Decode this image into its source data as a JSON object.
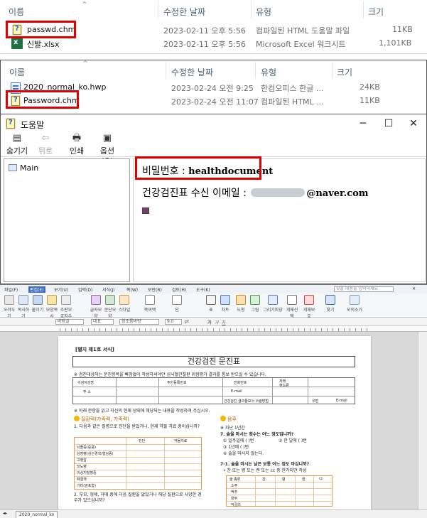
{
  "explorer_top": {
    "columns": {
      "name": "이름",
      "modified": "수정한 날짜",
      "type": "유형",
      "size": "크기"
    },
    "files": [
      {
        "name": "passwd.chm",
        "modified": "2023-02-11 오후 5:56",
        "type": "컴파일된 HTML 도움말 파일",
        "size": "11KB",
        "icon": "chm-help-icon"
      },
      {
        "name": "신발.xlsx",
        "modified": "2023-02-11 오후 5:56",
        "type": "Microsoft Excel 워크시트",
        "size": "1,101KB",
        "icon": "excel-file-icon"
      }
    ]
  },
  "explorer_bottom": {
    "columns": {
      "name": "이름",
      "modified": "수정한 날짜",
      "type": "유형",
      "size": "크기"
    },
    "files": [
      {
        "name": "2020_normal_ko.hwp",
        "modified": "2023-02-24 오전 9:25",
        "type": "한컴오피스 한글 ...",
        "size": "24KB",
        "icon": "hwp-file-icon"
      },
      {
        "name": "Password.chm",
        "modified": "2023-02-24 오전 11:07",
        "type": "컴파일된 HTML ...",
        "size": "11KB",
        "icon": "chm-help-icon"
      }
    ]
  },
  "help_window": {
    "title": "도움말",
    "toolbar": {
      "hide": "숨기기",
      "back": "뒤로",
      "print": "인쇄",
      "options": "옵션(O)"
    },
    "nav_item": "Main",
    "password_label": "비밀번호 : ",
    "password_value": "healthdocument",
    "email_label": "건강검진표 수신 이메일 : ",
    "email_domain": "@naver.com"
  },
  "hwp_editor": {
    "menu": [
      "파일(F)",
      "편집(E)",
      "보기(U)",
      "입력(D)",
      "서식(J)",
      "쪽(W)",
      "보안(R)",
      "검토(H)",
      "도구(K)"
    ],
    "search_placeholder": "찾을 내용을 입력하세요",
    "ribbon": [
      "오려두기",
      "복사하기",
      "붙이기",
      "모양복사",
      "조판부호지우기",
      "글자모양",
      "문단모양",
      "스타일",
      "쪽여백",
      "단",
      "표",
      "차트",
      "도형",
      "그림",
      "그리기마당",
      "개체선택",
      "개체보호",
      "찾기",
      "모의소거"
    ],
    "format": {
      "style": "바탕글",
      "font_face": "대표",
      "font_name": "함초롬바탕",
      "font_size": "9.0",
      "unit": "pt"
    },
    "status_tab": "2020_normal_ko",
    "document": {
      "form_tag": "[별지 제1호 서식]",
      "title": "건강검진 문진표",
      "note": "※ 검진대상자는 문진항목을 빠짐없이 작성하셔야만 심뇌혈관질환 위험평가 결과를 통보 받으실 수 있습니다.",
      "table_labels": [
        "수검자성명",
        "주민등록번호",
        "전화번호",
        "자택",
        "핸드폰",
        "주 소",
        "E-mail",
        "건강검진 결과통보서 수령방법",
        "우편",
        "E-mail"
      ],
      "note2": "※ 아래 문항을 읽고 자신의 현재 상태에 해당되는 내용을 작성하여 주십시오.",
      "section1": "질환력(가족력, 가족력)",
      "q1": "1. 다음과 같은 질병으로 진단을 받았거나, 현재 약물 치료 중이십니까?",
      "q1_diseases": [
        "뇌졸중(중풍)",
        "심장병(심근경색/협심증)",
        "고혈압",
        "당뇨병",
        "이상지질혈증",
        "폐결핵",
        "기타(암포함)"
      ],
      "q1_cols": [
        "진단",
        "약물치료"
      ],
      "q2": "2. 부모, 형제, 자매 중에 다음 질환을 앓았거나 해당 질환으로 사망한 경우가 있으십니까?",
      "section2": "음주",
      "q7_sub": "※ 지난 1년간",
      "q7": "7. 술을 마시는 횟수는 어느 정도입니까?",
      "q7_opts": [
        "① 일주일에 (    )번",
        "② 한 달에 (    )번",
        "③ 1년에 (    )번",
        "④ 술을 마시지 않는다."
      ],
      "q71": "7-1. 술을 마시는 날은 보통 어느 정도 마십니까?",
      "q71_note": "• 잔 또는 병 또는 캔 또는 cc 중 한가지만 작성",
      "q71_cols": [
        "술 종류",
        "잔",
        "병",
        "캔",
        "cc"
      ],
      "q71_rows": [
        "소주",
        "맥주",
        "양주",
        "막걸리"
      ]
    }
  }
}
